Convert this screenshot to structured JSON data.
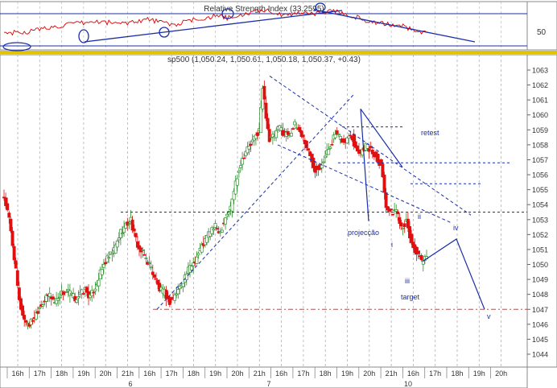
{
  "rsi_panel": {
    "title": "Relative Strength Index (33.2595)",
    "level_label": "50"
  },
  "price_panel": {
    "title": "sp500 (1,050.24, 1,050.61, 1,050.18, 1,050.37, +0.43)",
    "annotations": {
      "retest": "retest",
      "projection": "projecção",
      "target": "target",
      "wave_i": "i",
      "wave_ii": "ii",
      "wave_iii": "iii",
      "wave_iv": "iv",
      "wave_v": "v"
    }
  },
  "colors": {
    "up_candle": "#2f8f2f",
    "down_candle": "#e01010",
    "rsi_line": "#e00000",
    "trend_line": "#1a2fa8",
    "target_line": "#b05050",
    "grid": "#b0b0b0"
  },
  "chart_data": {
    "type": "candlestick",
    "title": "sp500 (1,050.24, 1,050.61, 1,050.18, 1,050.37, +0.43)",
    "ylim": [
      1043.5,
      1064
    ],
    "y_ticks": [
      1044,
      1045,
      1046,
      1047,
      1048,
      1049,
      1050,
      1051,
      1052,
      1053,
      1054,
      1055,
      1056,
      1057,
      1058,
      1059,
      1060,
      1061,
      1062,
      1063
    ],
    "x_tick_labels": [
      "16h",
      "17h",
      "18h",
      "19h",
      "20h",
      "21h",
      "16h",
      "17h",
      "18h",
      "19h",
      "20h",
      "21h",
      "16h",
      "17h",
      "18h",
      "19h",
      "20h",
      "21h",
      "16h",
      "17h",
      "18h",
      "19h",
      "20h"
    ],
    "day_labels": [
      "6",
      "7",
      "10"
    ],
    "levels": {
      "target": 1047,
      "resistance": 1053.5,
      "retest": 1056.8
    },
    "close_path": [
      [
        0,
        1054.5
      ],
      [
        3,
        1053
      ],
      [
        6,
        1050.5
      ],
      [
        9,
        1047.5
      ],
      [
        12,
        1046.3
      ],
      [
        15,
        1046
      ],
      [
        18,
        1046.5
      ],
      [
        21,
        1047.2
      ],
      [
        24,
        1047.6
      ],
      [
        27,
        1048
      ],
      [
        30,
        1047.5
      ],
      [
        33,
        1048
      ],
      [
        36,
        1048.2
      ],
      [
        39,
        1048.1
      ],
      [
        42,
        1047.7
      ],
      [
        45,
        1048
      ],
      [
        48,
        1048.3
      ],
      [
        51,
        1047.8
      ],
      [
        54,
        1048.5
      ],
      [
        57,
        1049.4
      ],
      [
        60,
        1050.2
      ],
      [
        63,
        1050.6
      ],
      [
        66,
        1051.2
      ],
      [
        69,
        1052.2
      ],
      [
        72,
        1052.6
      ],
      [
        75,
        1053
      ],
      [
        77,
        1052
      ],
      [
        80,
        1051
      ],
      [
        83,
        1050.6
      ],
      [
        86,
        1050
      ],
      [
        89,
        1049.2
      ],
      [
        92,
        1048.3
      ],
      [
        95,
        1048.1
      ],
      [
        98,
        1047.5
      ],
      [
        101,
        1047.9
      ],
      [
        104,
        1048.5
      ],
      [
        107,
        1049.2
      ],
      [
        110,
        1049.8
      ],
      [
        113,
        1050.3
      ],
      [
        116,
        1051
      ],
      [
        119,
        1051.6
      ],
      [
        122,
        1052.3
      ],
      [
        125,
        1052.5
      ],
      [
        128,
        1052.2
      ],
      [
        131,
        1053.2
      ],
      [
        134,
        1053.8
      ],
      [
        137,
        1055.5
      ],
      [
        140,
        1056.8
      ],
      [
        143,
        1057.6
      ],
      [
        146,
        1058
      ],
      [
        149,
        1058.6
      ],
      [
        151,
        1059
      ],
      [
        153,
        1061.8
      ],
      [
        155,
        1060
      ],
      [
        157,
        1058.3
      ],
      [
        160,
        1058.6
      ],
      [
        163,
        1059.2
      ],
      [
        166,
        1058.7
      ],
      [
        169,
        1058.8
      ],
      [
        172,
        1059.3
      ],
      [
        175,
        1058.9
      ],
      [
        178,
        1058.2
      ],
      [
        181,
        1057.2
      ],
      [
        184,
        1056.4
      ],
      [
        187,
        1056.6
      ],
      [
        190,
        1057.2
      ],
      [
        193,
        1058
      ],
      [
        196,
        1058.7
      ],
      [
        199,
        1058.4
      ],
      [
        202,
        1058.2
      ],
      [
        205,
        1058.8
      ],
      [
        208,
        1057.8
      ],
      [
        211,
        1057.5
      ],
      [
        214,
        1058
      ],
      [
        217,
        1057.6
      ],
      [
        220,
        1057.2
      ],
      [
        223,
        1056.7
      ],
      [
        226,
        1054
      ],
      [
        229,
        1053.4
      ],
      [
        232,
        1053.7
      ],
      [
        235,
        1052.6
      ],
      [
        238,
        1052.8
      ],
      [
        241,
        1051.4
      ],
      [
        244,
        1050.7
      ],
      [
        247,
        1050.2
      ],
      [
        250,
        1050.37
      ]
    ],
    "rsi": {
      "title": "Relative Strength Index (33.2595)",
      "current": 33.2595,
      "path": [
        [
          0,
          46
        ],
        [
          12,
          47
        ],
        [
          25,
          52
        ],
        [
          40,
          57
        ],
        [
          55,
          60
        ],
        [
          70,
          58
        ],
        [
          85,
          63
        ],
        [
          100,
          56
        ],
        [
          112,
          62
        ],
        [
          125,
          67
        ],
        [
          135,
          64
        ],
        [
          145,
          71
        ],
        [
          155,
          75
        ],
        [
          165,
          67
        ],
        [
          175,
          72
        ],
        [
          185,
          70
        ],
        [
          195,
          74
        ],
        [
          205,
          68
        ],
        [
          215,
          61
        ],
        [
          225,
          57
        ],
        [
          235,
          55
        ],
        [
          245,
          48
        ],
        [
          250,
          46
        ]
      ]
    }
  }
}
